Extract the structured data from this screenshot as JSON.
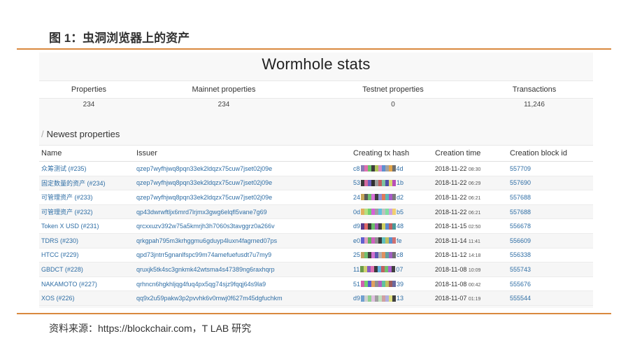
{
  "figure": {
    "title": "图 1：虫洞浏览器上的资产",
    "source": "资料来源：https://blockchair.com，T LAB 研究"
  },
  "stats": {
    "title": "Wormhole stats",
    "headers": [
      "Properties",
      "Mainnet properties",
      "Testnet properties",
      "Transactions"
    ],
    "values": [
      "234",
      "234",
      "0",
      "11,246"
    ]
  },
  "newest": {
    "section_title": "Newest properties",
    "columns": [
      "Name",
      "Issuer",
      "Creating tx hash",
      "Creation time",
      "Creation block id"
    ],
    "rows": [
      {
        "name": "众筹测试 (#235)",
        "issuer": "qzep7wyfhjwq8pqn33ek2ldqzx75cuw7jset02j09e",
        "hash_pre": "c8",
        "hash_post": "4d",
        "date": "2018-11-22",
        "time": "08:30",
        "block": "557709",
        "swatches": [
          "#8a7ab5",
          "#e06fae",
          "#6ec26b",
          "#3c3c3c",
          "#b0c45a",
          "#d58ccb",
          "#5d8fd1",
          "#a3a3a3",
          "#e2a54a",
          "#6f6f6f"
        ]
      },
      {
        "name": "固定数量的资产 (#234)",
        "issuer": "qzep7wyfhjwq8pqn33ek2ldqzx75cuw7jset02j09e",
        "hash_pre": "53",
        "hash_post": "1b",
        "date": "2018-11-22",
        "time": "06:29",
        "block": "557690",
        "swatches": [
          "#3a3a3a",
          "#d46aa0",
          "#6a5fbf",
          "#2e2e2e",
          "#9b9b9b",
          "#c25f5f",
          "#7ec2a0",
          "#4f4fa8",
          "#d8d870",
          "#b84fb8"
        ]
      },
      {
        "name": "可管理资产 (#233)",
        "issuer": "qzep7wyfhjwq8pqn33ek2ldqzx75cuw7jset02j09e",
        "hash_pre": "24",
        "hash_post": "d2",
        "date": "2018-11-22",
        "time": "06:21",
        "block": "557688",
        "swatches": [
          "#c9a85a",
          "#5a5a5a",
          "#6fbf6f",
          "#d86fd8",
          "#3e3e3e",
          "#8f8fd8",
          "#e07a5a",
          "#5ab8b8",
          "#a85ac8",
          "#7a7a7a"
        ]
      },
      {
        "name": "可管理资产 (#232)",
        "issuer": "qp43dwrwftljx6mrd7lrjmx3gwg6elqfl5vane7g69",
        "hash_pre": "0d",
        "hash_post": "b5",
        "date": "2018-11-22",
        "time": "06:21",
        "block": "557688",
        "swatches": [
          "#e0b060",
          "#b8e080",
          "#70d070",
          "#d860d8",
          "#a0a0a0",
          "#60c0e0",
          "#c0c0c0",
          "#80e0a0",
          "#d0a0e0",
          "#f0d070"
        ]
      },
      {
        "name": "Token X USD (#231)",
        "issuer": "qrcxxuzv392w75a5kmrjh3h7060s3tavggrz0a266v",
        "hash_pre": "d9",
        "hash_post": "48",
        "date": "2018-11-15",
        "time": "02:50",
        "block": "556678",
        "swatches": [
          "#5a3a8a",
          "#e06a6a",
          "#3a3a3a",
          "#6ac06a",
          "#a05ab0",
          "#404040",
          "#d0d060",
          "#5a8ad0",
          "#c06060",
          "#4a9a9a"
        ]
      },
      {
        "name": "TDRS (#230)",
        "issuer": "qrkgpah795m3krhggmu6gduyp4luxn4fagrned07ps",
        "hash_pre": "e0",
        "hash_post": "fe",
        "date": "2018-11-14",
        "time": "11:41",
        "block": "556609",
        "swatches": [
          "#6060d0",
          "#e0a0c0",
          "#60b060",
          "#d060c0",
          "#909090",
          "#3a3a3a",
          "#60c0c0",
          "#c0c060",
          "#5a90d0",
          "#d07070"
        ]
      },
      {
        "name": "HTCC (#229)",
        "issuer": "qpd73jntrr5gnanlfspc99m74amefuefusdt7u7my9",
        "hash_pre": "25",
        "hash_post": "c8",
        "date": "2018-11-12",
        "time": "14:18",
        "block": "556338",
        "swatches": [
          "#c0a060",
          "#70c070",
          "#404040",
          "#d070d0",
          "#5a5ab0",
          "#b0b0b0",
          "#e09060",
          "#60a0a0",
          "#a060c0",
          "#707070"
        ]
      },
      {
        "name": "GBDCT (#228)",
        "issuer": "qruxjk5tk4sc3gnkmk42wtsma4s47389ng6raxhqrp",
        "hash_pre": "11",
        "hash_post": "07",
        "date": "2018-11-08",
        "time": "10:09",
        "block": "555743",
        "swatches": [
          "#6a9a4a",
          "#d0d070",
          "#8a5ac0",
          "#e070b0",
          "#3a3a3a",
          "#60b0e0",
          "#c06060",
          "#70c070",
          "#b060d0",
          "#404040"
        ]
      },
      {
        "name": "NAKAMOTO (#227)",
        "issuer": "qrhncn6hgkhljqg4fuq4px5qg74sjz9fqqj64s9la9",
        "hash_pre": "51",
        "hash_post": "39",
        "date": "2018-11-08",
        "time": "00:42",
        "block": "555676",
        "swatches": [
          "#d060b0",
          "#70d070",
          "#5a5ad0",
          "#e0a060",
          "#909090",
          "#b060c0",
          "#60c0a0",
          "#c0c060",
          "#a05a5a",
          "#6a6aa0"
        ]
      },
      {
        "name": "XOS (#226)",
        "issuer": "qq9x2u59pakw3p2pvvhk6v0mwj0f627m45dgfuchkm",
        "hash_pre": "d9",
        "hash_post": "13",
        "date": "2018-11-07",
        "time": "01:19",
        "block": "555544",
        "swatches": [
          "#70a0d0",
          "#d0d0d0",
          "#90d090",
          "#e0c0e0",
          "#a0a0a0",
          "#c0e0c0",
          "#d0a0a0",
          "#b0b0e0",
          "#e0e080",
          "#404040"
        ]
      }
    ]
  },
  "colors": {
    "accent_rule": "#d9893f",
    "link": "#2f6ea5"
  }
}
